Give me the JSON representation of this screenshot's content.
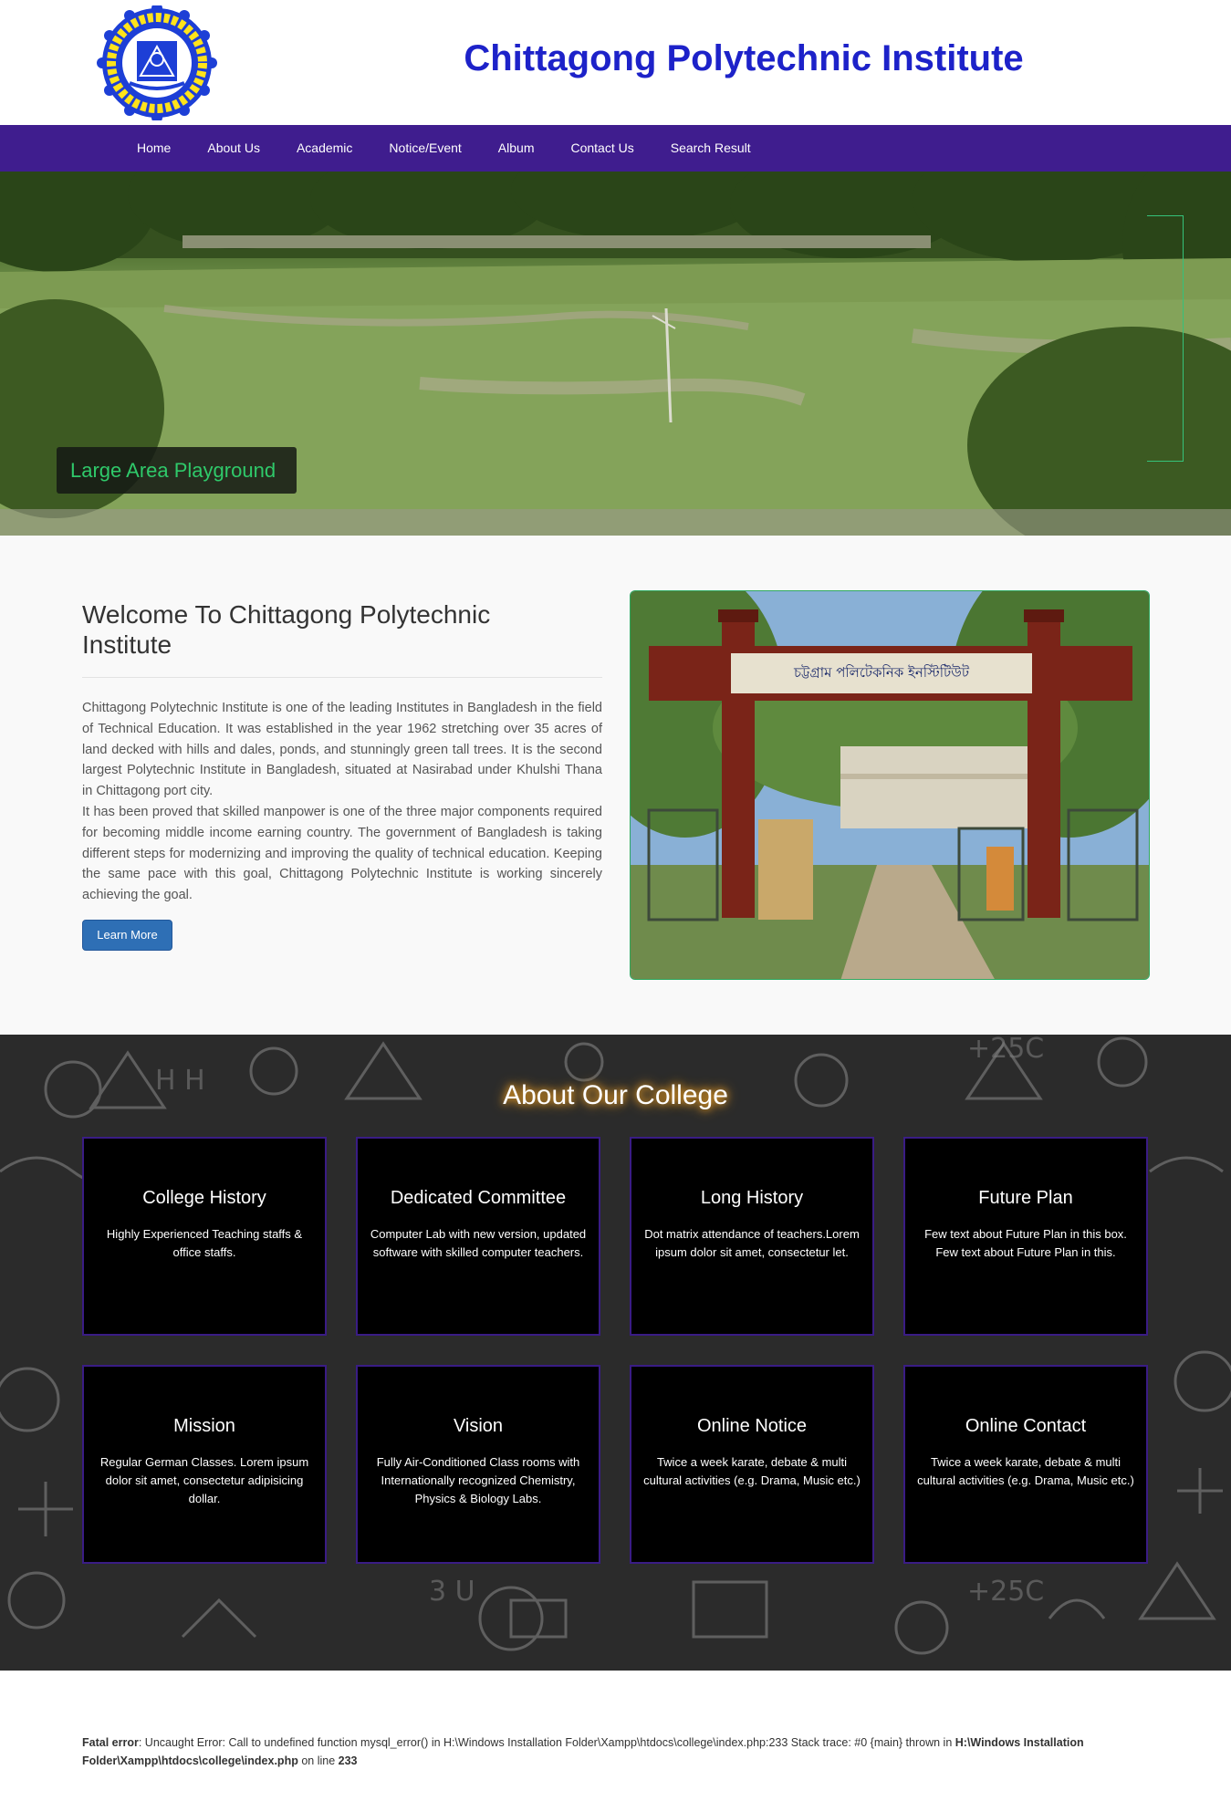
{
  "header": {
    "title": "Chittagong Polytechnic Institute",
    "logo_icon": "institute-seal-icon"
  },
  "nav": {
    "items": [
      "Home",
      "About Us",
      "Academic",
      "Notice/Event",
      "Album",
      "Contact Us",
      "Search Result"
    ]
  },
  "hero": {
    "caption": "Large Area Playground"
  },
  "welcome": {
    "title": "Welcome To Chittagong Polytechnic Institute",
    "paragraph1": "Chittagong Polytechnic Institute is one of the leading Institutes in Bangladesh in the field of Technical Education. It was established in the year 1962 stretching over 35 acres of land decked with hills and dales, ponds, and stunningly green tall trees. It is the second largest Polytechnic Institute in Bangladesh, situated at Nasirabad under Khulshi Thana in Chittagong port city.",
    "paragraph2": "It has been proved that skilled manpower is one of the three major components required for becoming middle income earning country. The government of Bangladesh is taking different steps for modernizing and improving the quality of technical education. Keeping the same pace with this goal, Chittagong Polytechnic Institute is working sincerely achieving the goal.",
    "button_label": "Learn More",
    "gate_sign": "চট্টগ্রাম পলিটেকনিক ইনস্টিটিউট"
  },
  "about": {
    "title": "About Our College",
    "cards": [
      {
        "title": "College History",
        "desc": "Highly Experienced Teaching staffs & office staffs."
      },
      {
        "title": "Dedicated Committee",
        "desc": "Computer Lab with new version, updated software with skilled computer teachers."
      },
      {
        "title": "Long History",
        "desc": "Dot matrix attendance of teachers.Lorem ipsum dolor sit amet, consectetur let."
      },
      {
        "title": "Future Plan",
        "desc": "Few text about Future Plan in this box. Few text about Future Plan in this."
      },
      {
        "title": "Mission",
        "desc": "Regular German Classes. Lorem ipsum dolor sit amet, consectetur adipisicing dollar."
      },
      {
        "title": "Vision",
        "desc": "Fully Air-Conditioned Class rooms with Internationally recognized Chemistry, Physics & Biology Labs."
      },
      {
        "title": "Online Notice",
        "desc": "Twice a week karate, debate & multi cultural activities (e.g. Drama, Music etc.)"
      },
      {
        "title": "Online Contact",
        "desc": "Twice a week karate, debate & multi cultural activities (e.g. Drama, Music etc.)"
      }
    ]
  },
  "error": {
    "label": "Fatal error",
    "message": ": Uncaught Error: Call to undefined function mysql_error() in H:\\Windows Installation Folder\\Xampp\\htdocs\\college\\index.php:233 Stack trace: #0 {main} thrown in ",
    "file": "H:\\Windows Installation Folder\\Xampp\\htdocs\\college\\index.php",
    "line_text": " on line ",
    "line": "233"
  },
  "colors": {
    "title_blue": "#1d22c9",
    "nav_purple": "#3f1d8e",
    "caption_green": "#2fc96a",
    "button_blue": "#2e6fb5",
    "card_border": "#3a1c85",
    "glow_orange": "#f6a423"
  }
}
